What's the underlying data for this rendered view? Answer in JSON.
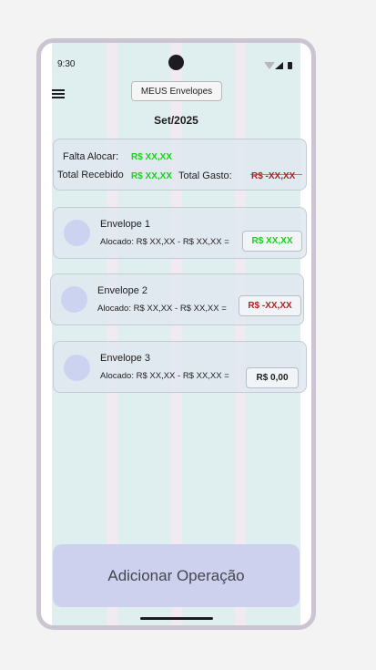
{
  "status_bar": {
    "time": "9:30"
  },
  "header": {
    "title_button": "MEUS Envelopes",
    "month": "Set/2025"
  },
  "summary": {
    "falta_alocar_label": "Falta Alocar:",
    "falta_alocar_value": "R$ XX,XX",
    "total_recebido_label": "Total Recebido",
    "total_recebido_value": "R$ XX,XX",
    "total_gasto_label": "Total Gasto:",
    "total_gasto_value": "R$ -XX,XX"
  },
  "envelopes": [
    {
      "name": "Envelope 1",
      "line": "Alocado: R$ XX,XX -  R$ XX,XX =",
      "value": "R$ XX,XX",
      "status": "positive"
    },
    {
      "name": "Envelope 2",
      "line": "Alocado: R$ XX,XX -  R$ XX,XX =",
      "value": "R$ -XX,XX",
      "status": "negative"
    },
    {
      "name": "Envelope 3",
      "line": "Alocado: R$ XX,XX -  R$ XX,XX =",
      "value": "R$ 0,00",
      "status": "zero"
    }
  ],
  "actions": {
    "add_operation": "Adicionar Operação"
  },
  "colors": {
    "positive": "#1bd01b",
    "negative": "#b12323",
    "accent": "#cdd1ee"
  },
  "icons": [
    "menu-icon",
    "camera-icon",
    "wifi-icon",
    "signal-icon",
    "battery-icon"
  ]
}
